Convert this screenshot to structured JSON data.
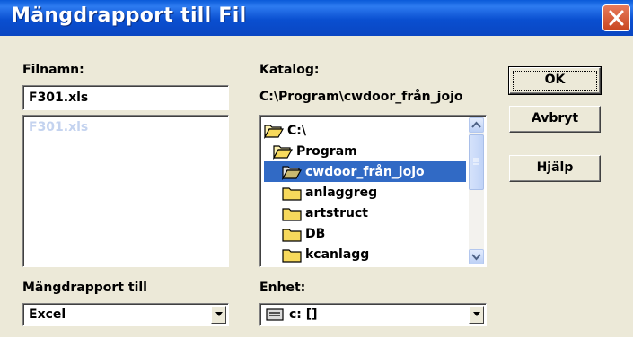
{
  "window": {
    "title": "Mängdrapport till Fil"
  },
  "filename": {
    "label": "Filnamn:",
    "value": "F301.xls",
    "list_items": [
      "F301.xls"
    ]
  },
  "directory": {
    "label": "Katalog:",
    "path": "C:\\Program\\cwdoor_från_jojo",
    "items": [
      {
        "label": "C:\\",
        "icon": "open-folder-icon"
      },
      {
        "label": "Program",
        "icon": "open-folder-icon"
      },
      {
        "label": "cwdoor_från_jojo",
        "icon": "open-folder-icon",
        "selected": true
      },
      {
        "label": "anlaggreg",
        "icon": "folder-icon"
      },
      {
        "label": "artstruct",
        "icon": "folder-icon"
      },
      {
        "label": "DB",
        "icon": "folder-icon"
      },
      {
        "label": "kcanlagg",
        "icon": "folder-icon"
      }
    ]
  },
  "buttons": {
    "ok": "OK",
    "cancel": "Avbryt",
    "help": "Hjälp"
  },
  "report_type": {
    "label": "Mängdrapport till",
    "value": "Excel"
  },
  "drive": {
    "label": "Enhet:",
    "value": "c: []",
    "icon": "drive-icon"
  },
  "colors": {
    "titlebar": "#0a4fd0",
    "selection": "#316ac5",
    "dialog_bg": "#ece9d8",
    "close_button": "#d0532b"
  }
}
